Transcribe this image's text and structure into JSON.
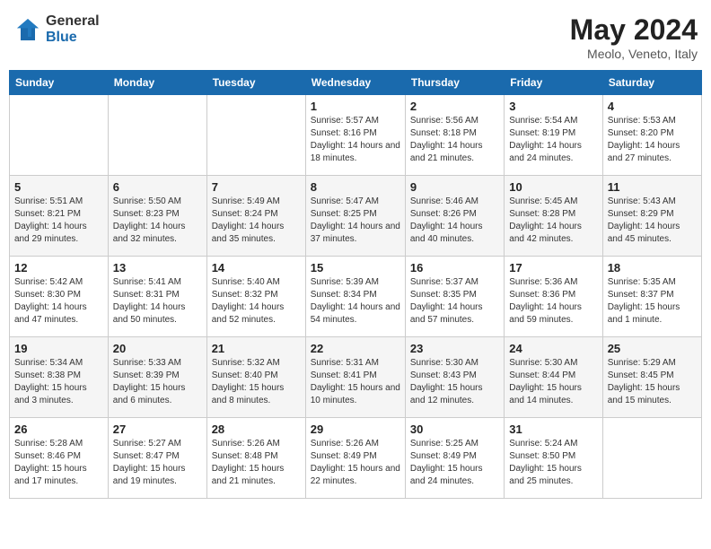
{
  "header": {
    "logo_general": "General",
    "logo_blue": "Blue",
    "title": "May 2024",
    "location": "Meolo, Veneto, Italy"
  },
  "weekdays": [
    "Sunday",
    "Monday",
    "Tuesday",
    "Wednesday",
    "Thursday",
    "Friday",
    "Saturday"
  ],
  "weeks": [
    [
      {
        "day": "",
        "info": ""
      },
      {
        "day": "",
        "info": ""
      },
      {
        "day": "",
        "info": ""
      },
      {
        "day": "1",
        "info": "Sunrise: 5:57 AM\nSunset: 8:16 PM\nDaylight: 14 hours and 18 minutes."
      },
      {
        "day": "2",
        "info": "Sunrise: 5:56 AM\nSunset: 8:18 PM\nDaylight: 14 hours and 21 minutes."
      },
      {
        "day": "3",
        "info": "Sunrise: 5:54 AM\nSunset: 8:19 PM\nDaylight: 14 hours and 24 minutes."
      },
      {
        "day": "4",
        "info": "Sunrise: 5:53 AM\nSunset: 8:20 PM\nDaylight: 14 hours and 27 minutes."
      }
    ],
    [
      {
        "day": "5",
        "info": "Sunrise: 5:51 AM\nSunset: 8:21 PM\nDaylight: 14 hours and 29 minutes."
      },
      {
        "day": "6",
        "info": "Sunrise: 5:50 AM\nSunset: 8:23 PM\nDaylight: 14 hours and 32 minutes."
      },
      {
        "day": "7",
        "info": "Sunrise: 5:49 AM\nSunset: 8:24 PM\nDaylight: 14 hours and 35 minutes."
      },
      {
        "day": "8",
        "info": "Sunrise: 5:47 AM\nSunset: 8:25 PM\nDaylight: 14 hours and 37 minutes."
      },
      {
        "day": "9",
        "info": "Sunrise: 5:46 AM\nSunset: 8:26 PM\nDaylight: 14 hours and 40 minutes."
      },
      {
        "day": "10",
        "info": "Sunrise: 5:45 AM\nSunset: 8:28 PM\nDaylight: 14 hours and 42 minutes."
      },
      {
        "day": "11",
        "info": "Sunrise: 5:43 AM\nSunset: 8:29 PM\nDaylight: 14 hours and 45 minutes."
      }
    ],
    [
      {
        "day": "12",
        "info": "Sunrise: 5:42 AM\nSunset: 8:30 PM\nDaylight: 14 hours and 47 minutes."
      },
      {
        "day": "13",
        "info": "Sunrise: 5:41 AM\nSunset: 8:31 PM\nDaylight: 14 hours and 50 minutes."
      },
      {
        "day": "14",
        "info": "Sunrise: 5:40 AM\nSunset: 8:32 PM\nDaylight: 14 hours and 52 minutes."
      },
      {
        "day": "15",
        "info": "Sunrise: 5:39 AM\nSunset: 8:34 PM\nDaylight: 14 hours and 54 minutes."
      },
      {
        "day": "16",
        "info": "Sunrise: 5:37 AM\nSunset: 8:35 PM\nDaylight: 14 hours and 57 minutes."
      },
      {
        "day": "17",
        "info": "Sunrise: 5:36 AM\nSunset: 8:36 PM\nDaylight: 14 hours and 59 minutes."
      },
      {
        "day": "18",
        "info": "Sunrise: 5:35 AM\nSunset: 8:37 PM\nDaylight: 15 hours and 1 minute."
      }
    ],
    [
      {
        "day": "19",
        "info": "Sunrise: 5:34 AM\nSunset: 8:38 PM\nDaylight: 15 hours and 3 minutes."
      },
      {
        "day": "20",
        "info": "Sunrise: 5:33 AM\nSunset: 8:39 PM\nDaylight: 15 hours and 6 minutes."
      },
      {
        "day": "21",
        "info": "Sunrise: 5:32 AM\nSunset: 8:40 PM\nDaylight: 15 hours and 8 minutes."
      },
      {
        "day": "22",
        "info": "Sunrise: 5:31 AM\nSunset: 8:41 PM\nDaylight: 15 hours and 10 minutes."
      },
      {
        "day": "23",
        "info": "Sunrise: 5:30 AM\nSunset: 8:43 PM\nDaylight: 15 hours and 12 minutes."
      },
      {
        "day": "24",
        "info": "Sunrise: 5:30 AM\nSunset: 8:44 PM\nDaylight: 15 hours and 14 minutes."
      },
      {
        "day": "25",
        "info": "Sunrise: 5:29 AM\nSunset: 8:45 PM\nDaylight: 15 hours and 15 minutes."
      }
    ],
    [
      {
        "day": "26",
        "info": "Sunrise: 5:28 AM\nSunset: 8:46 PM\nDaylight: 15 hours and 17 minutes."
      },
      {
        "day": "27",
        "info": "Sunrise: 5:27 AM\nSunset: 8:47 PM\nDaylight: 15 hours and 19 minutes."
      },
      {
        "day": "28",
        "info": "Sunrise: 5:26 AM\nSunset: 8:48 PM\nDaylight: 15 hours and 21 minutes."
      },
      {
        "day": "29",
        "info": "Sunrise: 5:26 AM\nSunset: 8:49 PM\nDaylight: 15 hours and 22 minutes."
      },
      {
        "day": "30",
        "info": "Sunrise: 5:25 AM\nSunset: 8:49 PM\nDaylight: 15 hours and 24 minutes."
      },
      {
        "day": "31",
        "info": "Sunrise: 5:24 AM\nSunset: 8:50 PM\nDaylight: 15 hours and 25 minutes."
      },
      {
        "day": "",
        "info": ""
      }
    ]
  ]
}
